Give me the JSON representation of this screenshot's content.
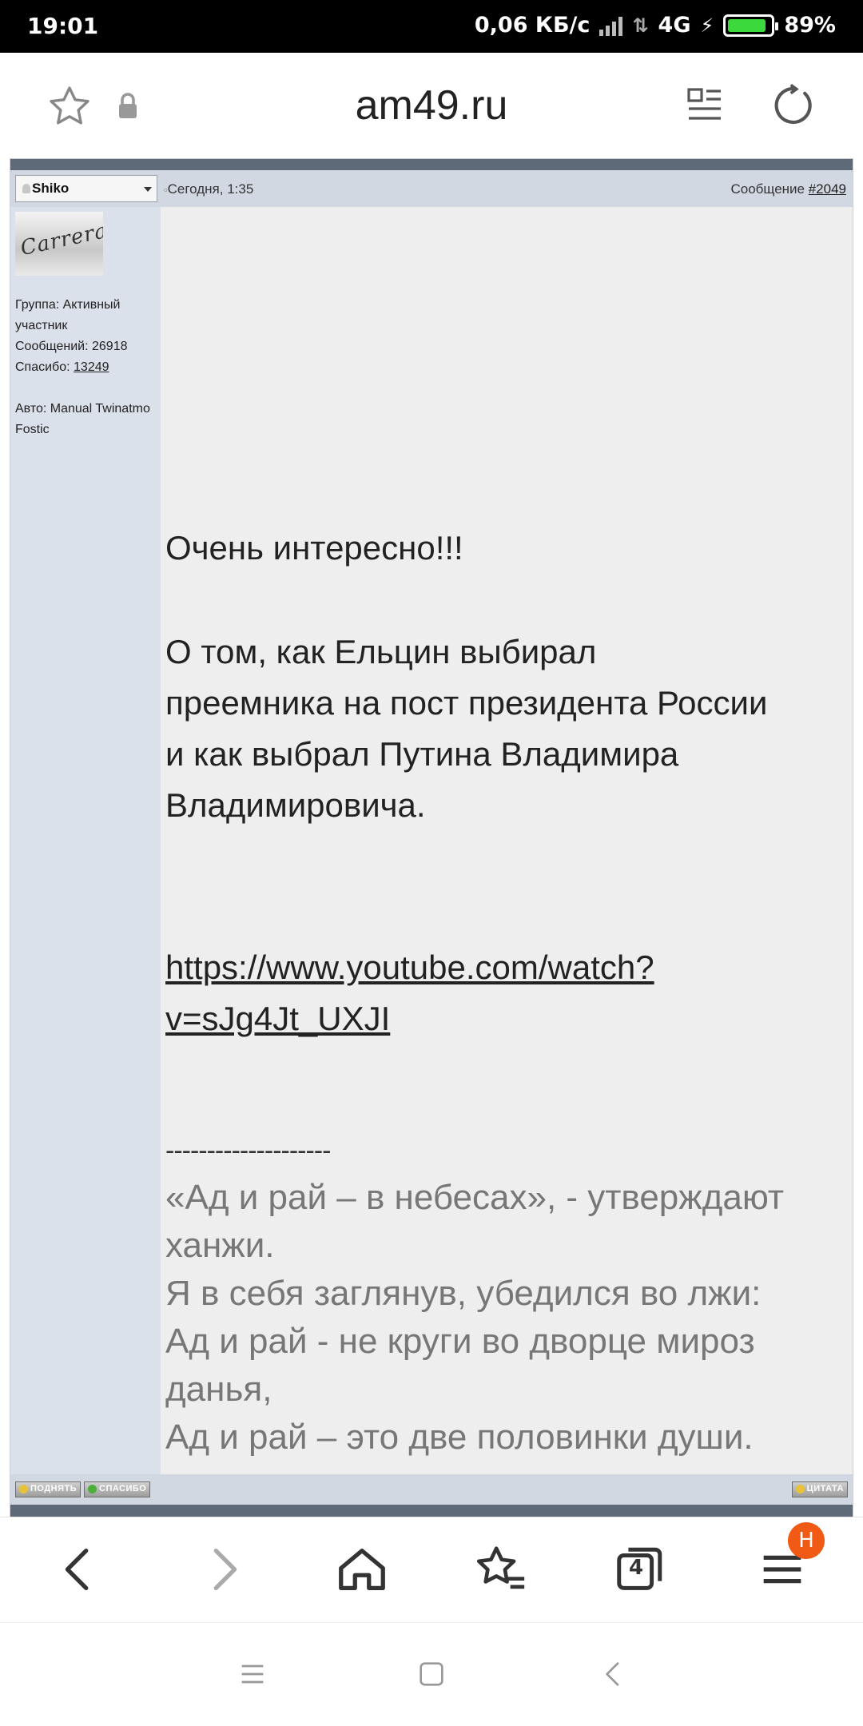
{
  "status_bar": {
    "time": "19:01",
    "speed": "0,06 КБ/с",
    "network": "4G",
    "battery": "89%",
    "battery_level": 0.89
  },
  "browser": {
    "url": "am49.ru",
    "tabs_count": "4",
    "menu_badge": "H"
  },
  "post": {
    "username": "Shiko",
    "date": "Сегодня, 1:35",
    "message_label": "Сообщение ",
    "message_number": "#2049",
    "avatar_text": "Carrera",
    "user_group": "Группа: Активный участник",
    "user_posts": "Сообщений: 26918",
    "thanks_label": "Спасибо: ",
    "thanks_count": "13249",
    "auto": "Авто: Manual Twinatmo Fostic",
    "text_1": "Очень интересно!!!",
    "text_2": "О том, как Ельцин выбирал преемника на пост президента России и как выбрал Путина Владимира Владимировича.",
    "link": "https://www.youtube.com/watch?v=sJg4Jt_UXJI",
    "signature_separator": "--------------------",
    "signature_lines": [
      "«Ад и рай – в небесах», - утверждают ханжи.",
      "Я в себя заглянув, убедился во лжи:",
      "Ад и рай - не круги во дворце мироз данья,",
      "Ад и рай – это две половинки души."
    ],
    "buttons": {
      "raise": "ПОДНЯТЬ",
      "thanks": "СПАСИБО",
      "quote": "ЦИТАТА"
    }
  },
  "colors": {
    "header_bar": "#5f6a78",
    "post_header": "#d2d8e2",
    "sidebar": "#dbe1ea",
    "post_bg": "#eeeeee",
    "badge": "#f05a14"
  }
}
